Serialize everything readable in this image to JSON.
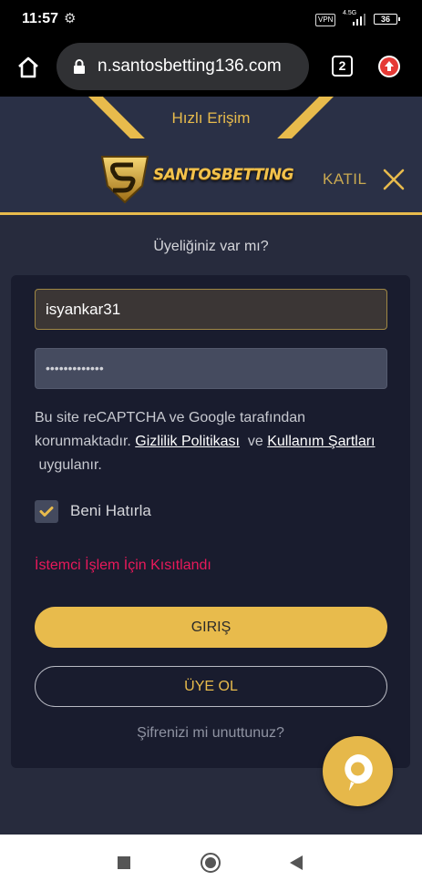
{
  "status_bar": {
    "time": "11:57",
    "vpn": "VPN",
    "network": "4.5G",
    "battery": "36"
  },
  "browser": {
    "url": "n.santosbetting136.com",
    "tab_count": "2"
  },
  "header": {
    "quick_access": "Hızlı Erişim",
    "logo_text": "SANTOSBETTING",
    "join": "KATIL"
  },
  "login": {
    "heading": "Üyeliğiniz var mı?",
    "username_value": "isyankar31",
    "password_value": "•••••••••••••",
    "recaptcha_text_1": "Bu site reCAPTCHA ve Google tarafından korunmaktadır.",
    "privacy_link": "Gizlilik Politikası",
    "recaptcha_and": "ve",
    "terms_link": "Kullanım Şartları",
    "recaptcha_text_2": "uygulanır.",
    "remember_me": "Beni Hatırla",
    "error": "İstemci İşlem İçin Kısıtlandı",
    "login_button": "GIRIŞ",
    "register_button": "ÜYE OL",
    "forgot_password": "Şifrenizi mi unuttunuz?"
  },
  "colors": {
    "accent": "#e8bb4c",
    "error": "#e8195b",
    "background": "#272b3d",
    "card": "#191c2e"
  },
  "icons": {
    "settings": "gear-icon",
    "home": "home-icon",
    "lock": "lock-icon",
    "update": "update-arrow-icon",
    "close": "close-icon",
    "check": "checkmark-icon",
    "chat": "chat-icon"
  }
}
